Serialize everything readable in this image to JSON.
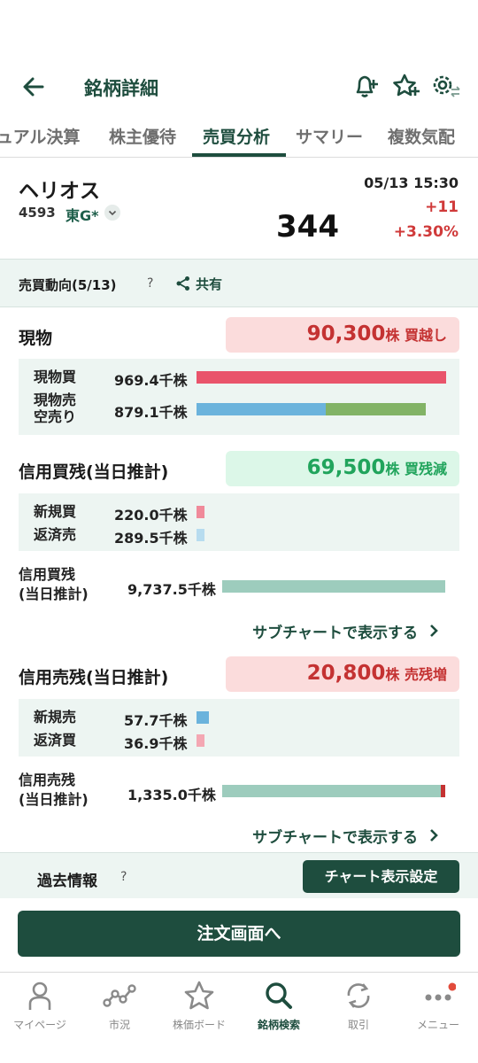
{
  "header": {
    "title": "銘柄詳細"
  },
  "tabs": [
    {
      "label": "ュアル決算"
    },
    {
      "label": "株主優待"
    },
    {
      "label": "売買分析"
    },
    {
      "label": "サマリー"
    },
    {
      "label": "複数気配"
    }
  ],
  "stock": {
    "name": "ヘリオス",
    "code": "4593",
    "market": "東G*",
    "datetime": "05/13 15:30",
    "price": "344",
    "change": "+11",
    "change_pct": "+3.30%"
  },
  "trend": {
    "title": "売買動向(5/13)",
    "help": "?",
    "share_label": "共有"
  },
  "genbutsu": {
    "title": "現物",
    "summary_value": "90,300",
    "summary_unit": "株 買越し",
    "rows": [
      {
        "label": "現物買",
        "value": "969.4千株"
      },
      {
        "label": "現物売\n空売り",
        "value": "879.1千株"
      }
    ]
  },
  "shinyou_kai": {
    "title": "信用買残(当日推計)",
    "summary_value": "69,500",
    "summary_unit": "株 買残減",
    "rows": [
      {
        "label": "新規買",
        "value": "220.0千株"
      },
      {
        "label": "返済売",
        "value": "289.5千株"
      }
    ],
    "total_label": "信用買残\n(当日推計)",
    "total_value": "9,737.5千株",
    "subchart_link": "サブチャートで表示する"
  },
  "shinyou_uri": {
    "title": "信用売残(当日推計)",
    "summary_value": "20,800",
    "summary_unit": "株 売残増",
    "rows": [
      {
        "label": "新規売",
        "value": "57.7千株"
      },
      {
        "label": "返済買",
        "value": "36.9千株"
      }
    ],
    "total_label": "信用売残\n(当日推計)",
    "total_value": "1,335.0千株",
    "subchart_link": "サブチャートで表示する"
  },
  "past": {
    "title": "過去情報",
    "help": "?",
    "chart_settings_label": "チャート表示設定"
  },
  "order_button": "注文画面へ",
  "nav": [
    {
      "label": "マイページ",
      "icon": "person-icon"
    },
    {
      "label": "市況",
      "icon": "market-icon"
    },
    {
      "label": "株価ボード",
      "icon": "star-icon"
    },
    {
      "label": "銘柄検索",
      "icon": "search-icon"
    },
    {
      "label": "取引",
      "icon": "trade-icon"
    },
    {
      "label": "メニュー",
      "icon": "menu-icon"
    }
  ],
  "colors": {
    "brand": "#1e4d3e",
    "buy_bar": "#e9546b",
    "sell_bar": "#6bb3dc",
    "short_bar": "#82b366",
    "total_bar": "#9dccbd",
    "up": "#d03a3a",
    "green_pill": "#21a45c"
  }
}
